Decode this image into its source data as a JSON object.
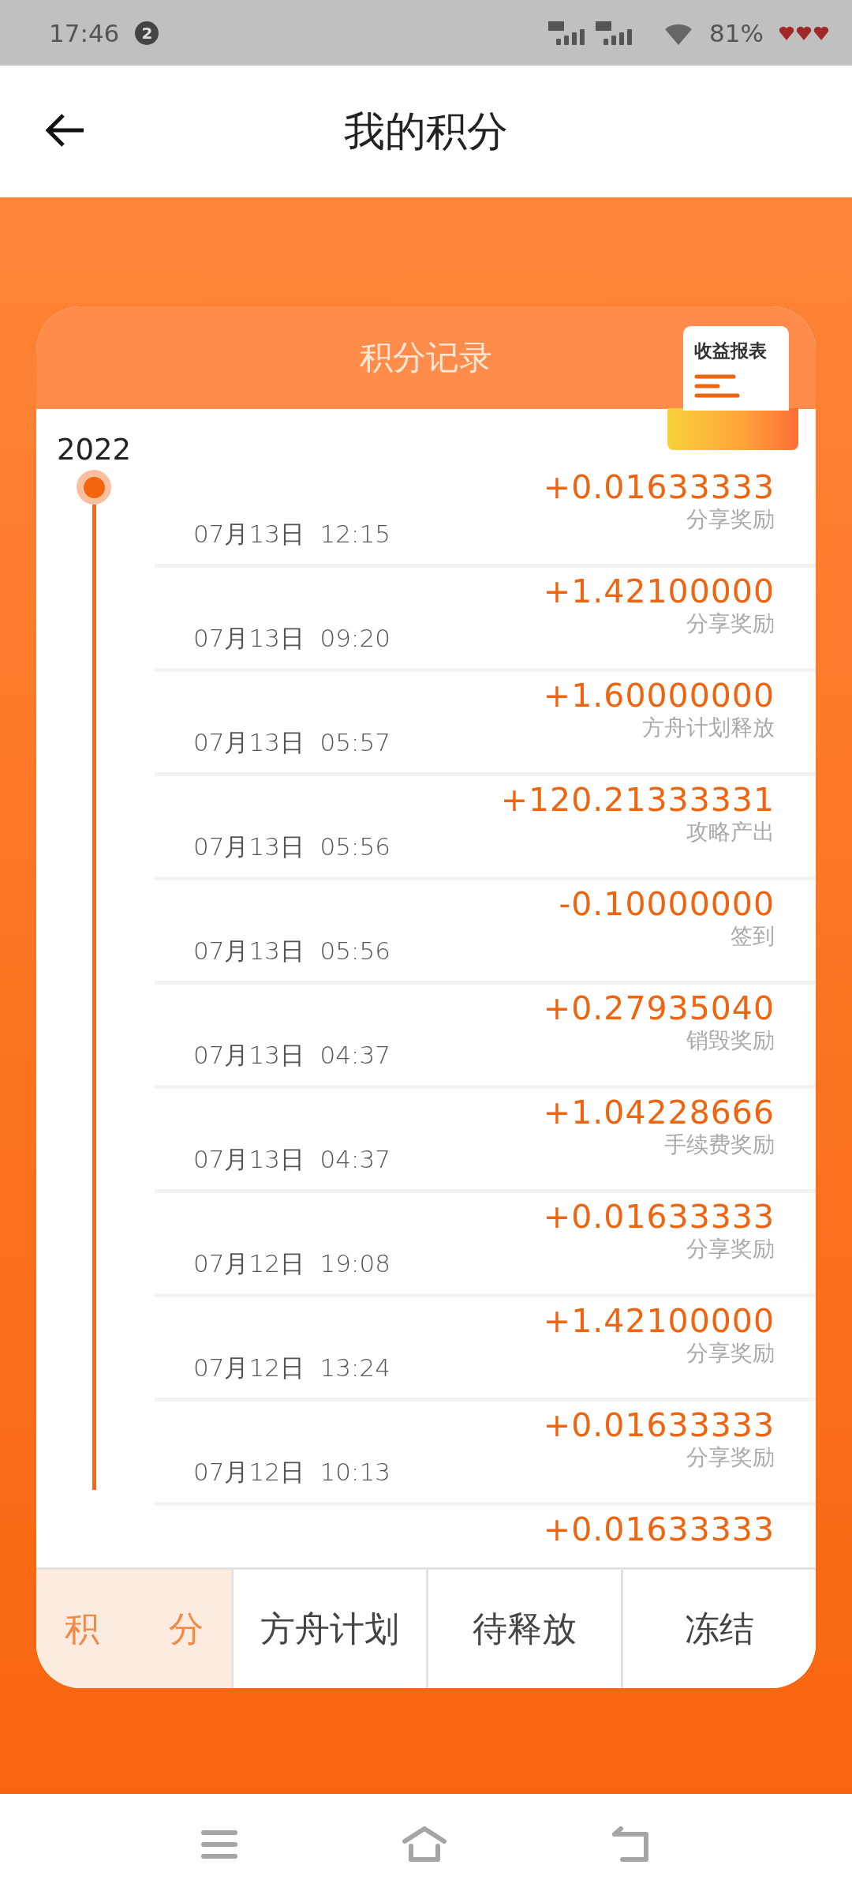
{
  "status_bar": {
    "time": "17:46",
    "notification_count": "2",
    "battery": "81%"
  },
  "header": {
    "title": "我的积分"
  },
  "card": {
    "title": "积分记录",
    "report_button": "收益报表",
    "year": "2022"
  },
  "records": [
    {
      "amount": "+0.01633333",
      "label": "分享奖励",
      "date": "07月13日  12:15"
    },
    {
      "amount": "+1.42100000",
      "label": "分享奖励",
      "date": "07月13日  09:20"
    },
    {
      "amount": "+1.60000000",
      "label": "方舟计划释放",
      "date": "07月13日  05:57"
    },
    {
      "amount": "+120.21333331",
      "label": "攻略产出",
      "date": "07月13日  05:56"
    },
    {
      "amount": "-0.10000000",
      "label": "签到",
      "date": "07月13日  05:56"
    },
    {
      "amount": "+0.27935040",
      "label": "销毁奖励",
      "date": "07月13日  04:37"
    },
    {
      "amount": "+1.04228666",
      "label": "手续费奖励",
      "date": "07月13日  04:37"
    },
    {
      "amount": "+0.01633333",
      "label": "分享奖励",
      "date": "07月12日  19:08"
    },
    {
      "amount": "+1.42100000",
      "label": "分享奖励",
      "date": "07月12日  13:24"
    },
    {
      "amount": "+0.01633333",
      "label": "分享奖励",
      "date": "07月12日  10:13"
    },
    {
      "amount": "+0.01633333"
    }
  ],
  "tabs": [
    {
      "label": "积　　分",
      "selected": true
    },
    {
      "label": "方舟计划",
      "selected": false
    },
    {
      "label": "待释放",
      "selected": false
    },
    {
      "label": "冻结",
      "selected": false
    }
  ]
}
